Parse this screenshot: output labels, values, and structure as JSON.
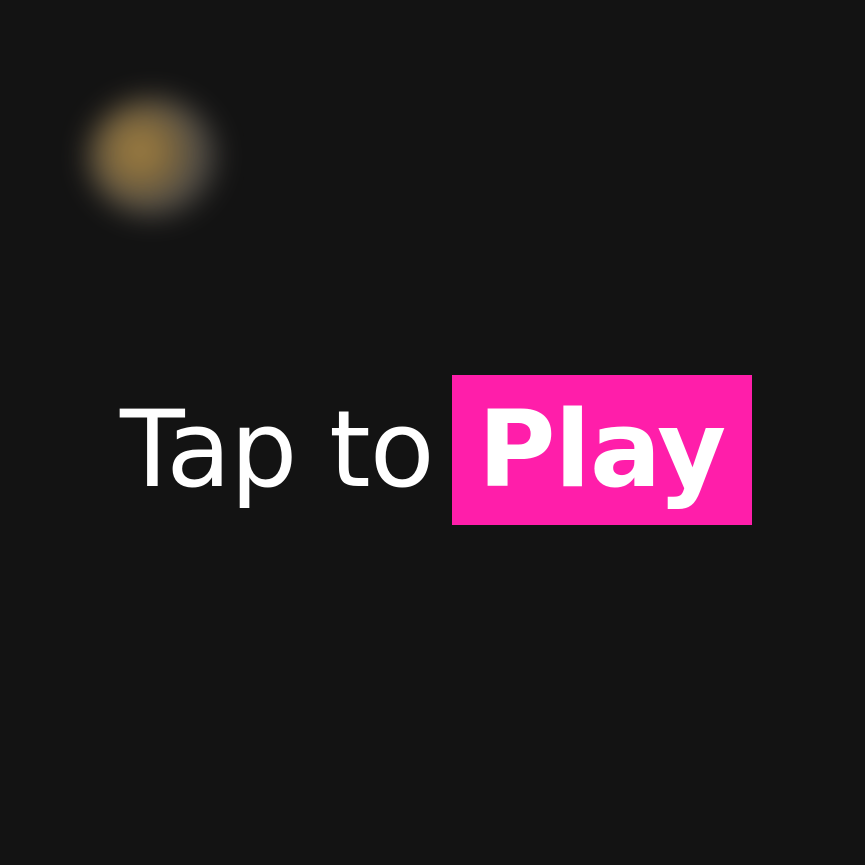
{
  "title_screen": {
    "prompt_lead": "Tap to",
    "prompt_action": "Play"
  },
  "colors": {
    "background": "#131313",
    "text": "#ffffff",
    "accent": "#ff1eaa",
    "glow": "#b8924a"
  }
}
